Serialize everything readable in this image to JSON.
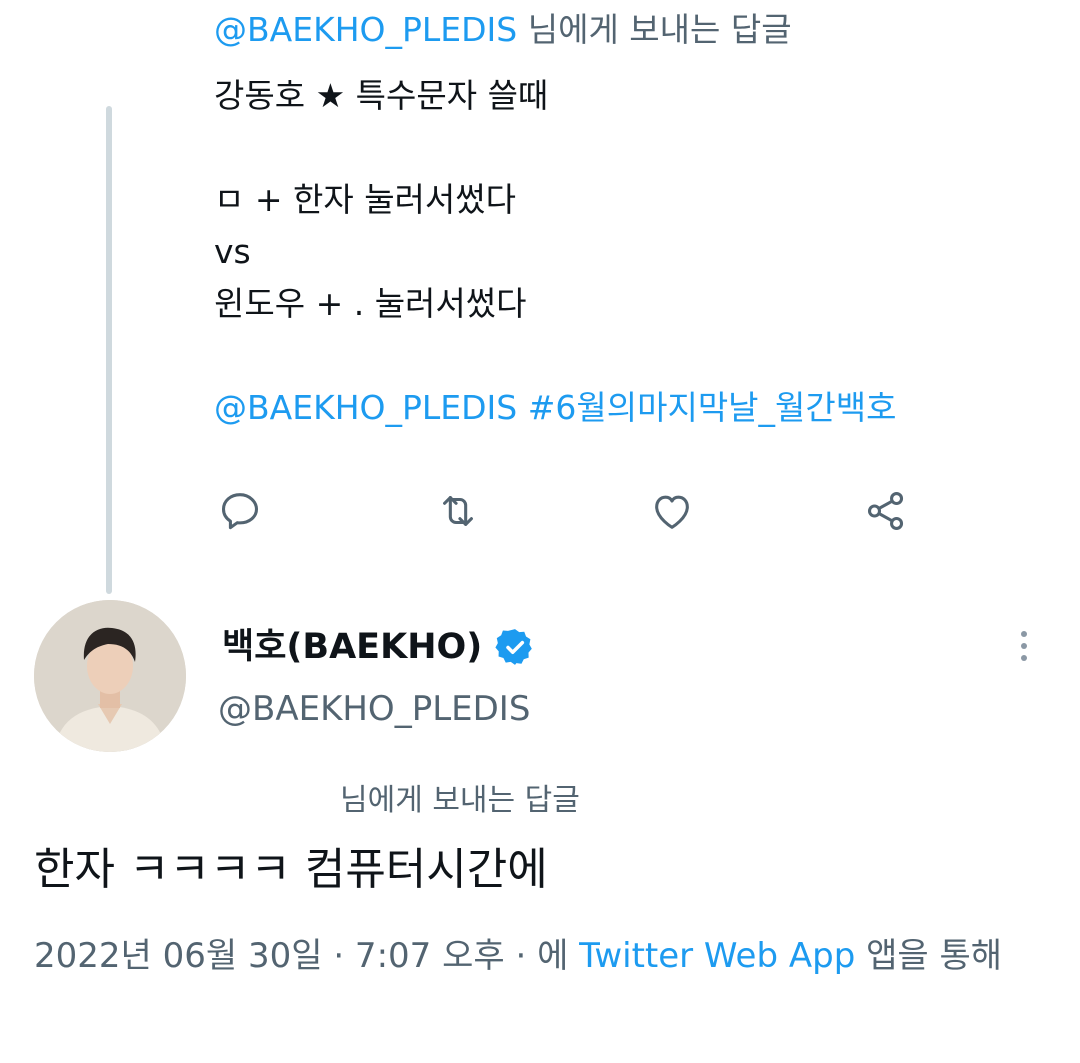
{
  "parent_tweet": {
    "reply_to_handle": "@BAEKHO_PLEDIS",
    "reply_to_suffix": " 님에게 보내는 답글",
    "text_lines": [
      "강동호 ★ 특수문자 쓸때",
      "",
      "ㅁ + 한자 눌러서썼다",
      "vs",
      "윈도우 + . 눌러서썼다",
      ""
    ],
    "mentions_line": {
      "mention": "@BAEKHO_PLEDIS",
      "hashtag": "#6월의마지막날_월간백호"
    },
    "actions": [
      "reply-icon",
      "retweet-icon",
      "like-icon",
      "share-icon"
    ]
  },
  "main_tweet": {
    "display_name": "백호(BAEKHO)",
    "handle": "@BAEKHO_PLEDIS",
    "verified": true,
    "reply_label": "님에게 보내는 답글",
    "text": "한자 ㅋㅋㅋㅋ 컴퓨터시간에",
    "timestamp": "2022년 06월 30일 · 7:07 오후 · 에",
    "source": "Twitter Web App",
    "source_suffix": "앱을 통해"
  },
  "colors": {
    "link": "#1d9bf0",
    "secondary_text": "#536471",
    "primary_text": "#0f1419",
    "thread_line": "#cfd9de"
  }
}
